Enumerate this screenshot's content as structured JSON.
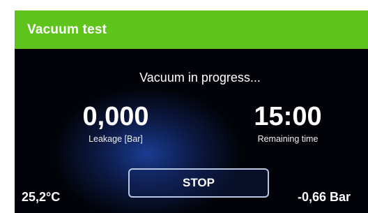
{
  "colors": {
    "header_green": "#5ec31a",
    "background": "#020308",
    "glow_blue": "#1e46aa",
    "text": "#ffffff"
  },
  "header": {
    "title": "Vacuum test"
  },
  "status": {
    "message": "Vacuum in progress..."
  },
  "readouts": {
    "leakage": {
      "value": "0,000",
      "label": "Leakage [Bar]"
    },
    "remaining_time": {
      "value": "15:00",
      "label": "Remaining time"
    }
  },
  "controls": {
    "stop_label": "STOP"
  },
  "footer": {
    "temperature": "25,2°C",
    "pressure": "-0,66 Bar"
  }
}
